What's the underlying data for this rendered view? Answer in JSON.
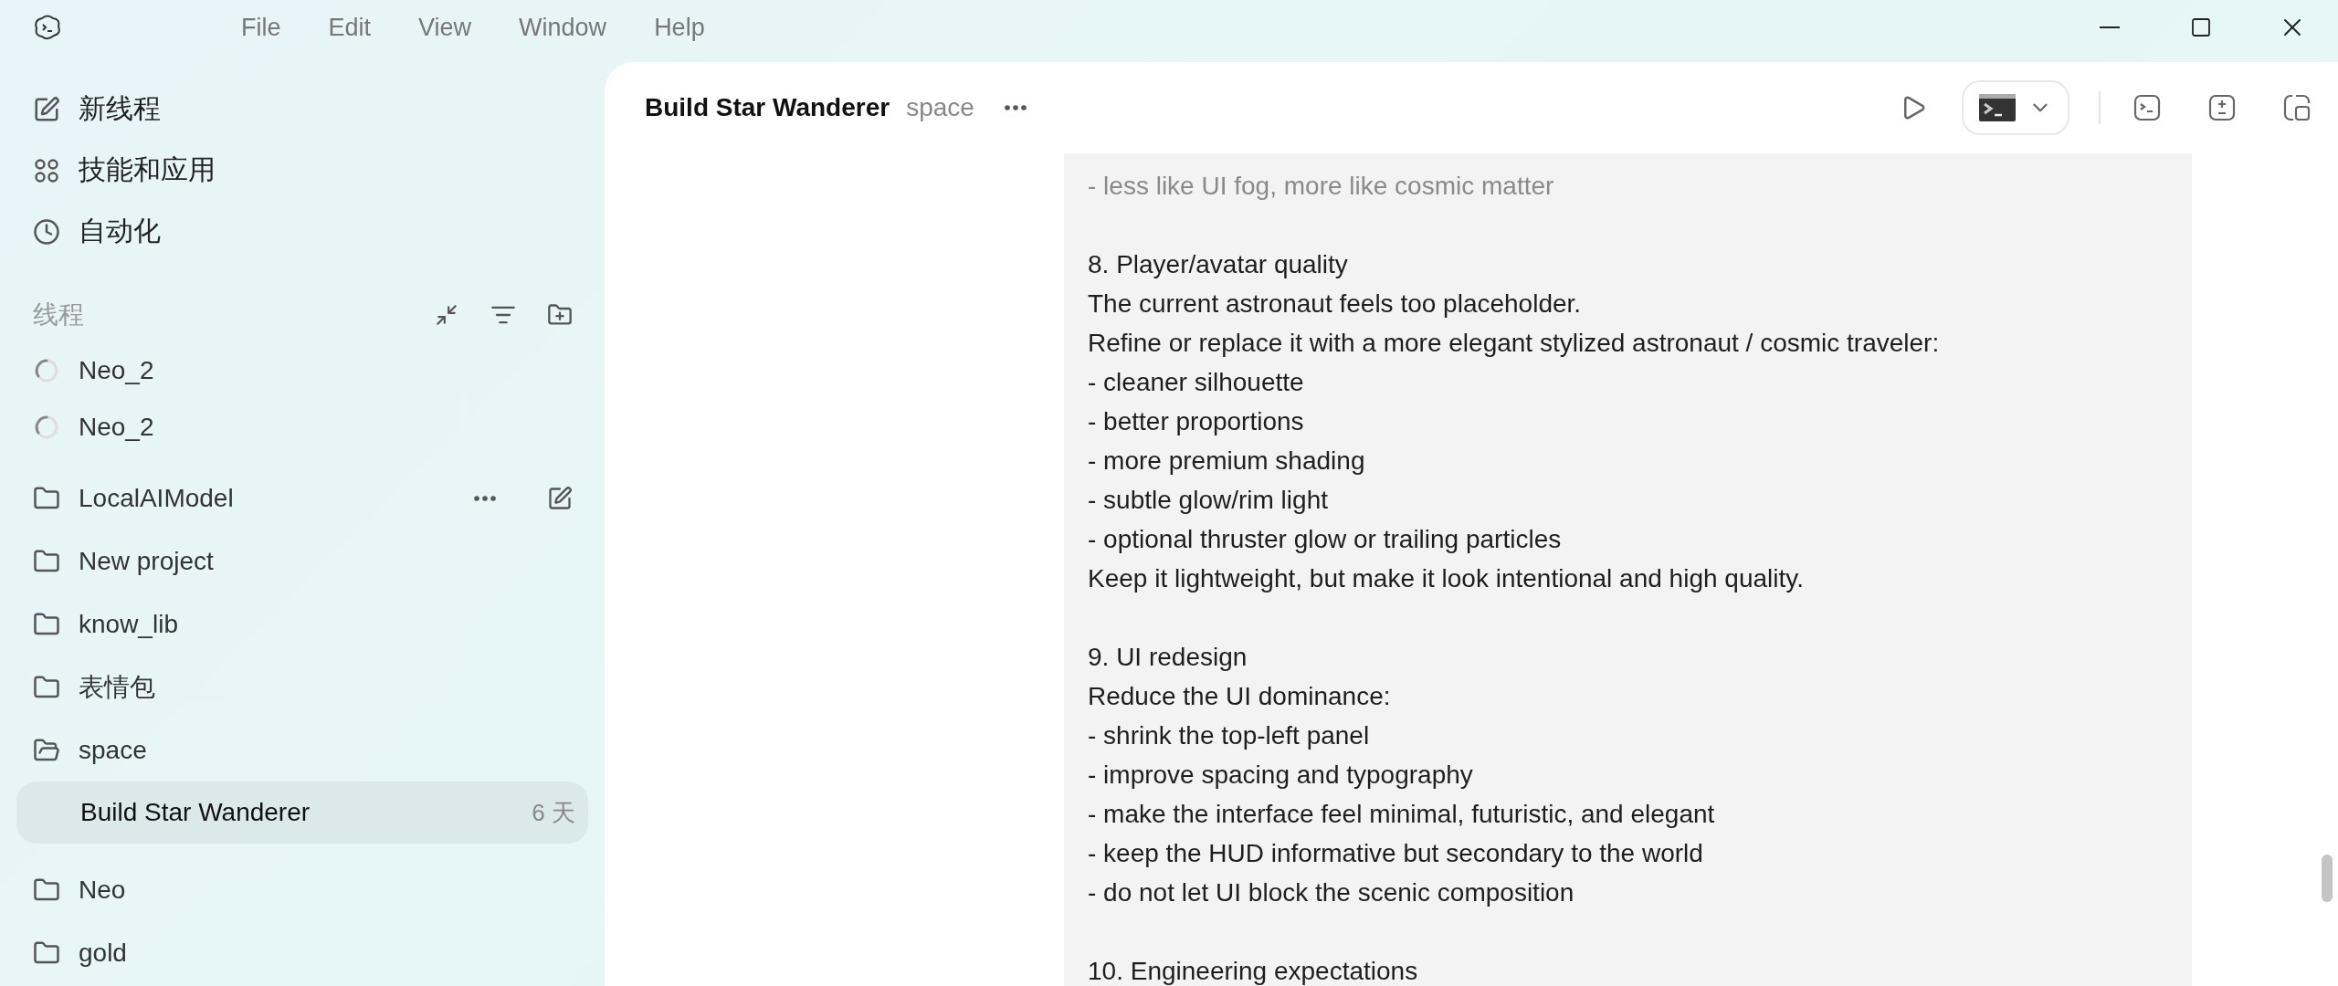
{
  "menu": [
    "File",
    "Edit",
    "View",
    "Window",
    "Help"
  ],
  "nav": [
    {
      "kind": "new",
      "label": "新线程"
    },
    {
      "kind": "apps",
      "label": "技能和应用"
    },
    {
      "kind": "clock",
      "label": "自动化"
    }
  ],
  "threads_header": {
    "label": "线程"
  },
  "threads": [
    {
      "label": "Neo_2",
      "running": true
    },
    {
      "label": "Neo_2",
      "running": true
    }
  ],
  "projects": [
    {
      "label": "LocalAIModel",
      "open": false,
      "actions_shown": true
    },
    {
      "label": "New project",
      "open": false,
      "actions_shown": false
    },
    {
      "label": "know_lib",
      "open": false,
      "actions_shown": false
    },
    {
      "label": "表情包",
      "open": false,
      "actions_shown": false
    },
    {
      "label": "space",
      "open": true,
      "actions_shown": false,
      "children": [
        {
          "label": "Build Star Wanderer",
          "age": "6 天",
          "selected": true
        }
      ]
    },
    {
      "label": "Neo",
      "open": false,
      "actions_shown": false
    },
    {
      "label": "gold",
      "open": false,
      "actions_shown": false
    }
  ],
  "header": {
    "title": "Build Star Wanderer",
    "project": "space"
  },
  "message": {
    "paragraphs": [
      {
        "faded": true,
        "lines": [
          "- less like UI fog, more like cosmic matter"
        ]
      },
      {
        "faded": false,
        "lines": [
          "8. Player/avatar quality",
          "The current astronaut feels too placeholder.",
          "Refine or replace it with a more elegant stylized astronaut / cosmic traveler:",
          "- cleaner silhouette",
          "- better proportions",
          "- more premium shading",
          "- subtle glow/rim light",
          "- optional thruster glow or trailing particles",
          "Keep it lightweight, but make it look intentional and high quality."
        ]
      },
      {
        "faded": false,
        "lines": [
          "9. UI redesign",
          "Reduce the UI dominance:",
          "- shrink the top-left panel",
          "- improve spacing and typography",
          "- make the interface feel minimal, futuristic, and elegant",
          "- keep the HUD informative but secondary to the world",
          "- do not let UI block the scenic composition"
        ]
      },
      {
        "faded": false,
        "lines": [
          "10. Engineering expectations"
        ]
      }
    ]
  }
}
